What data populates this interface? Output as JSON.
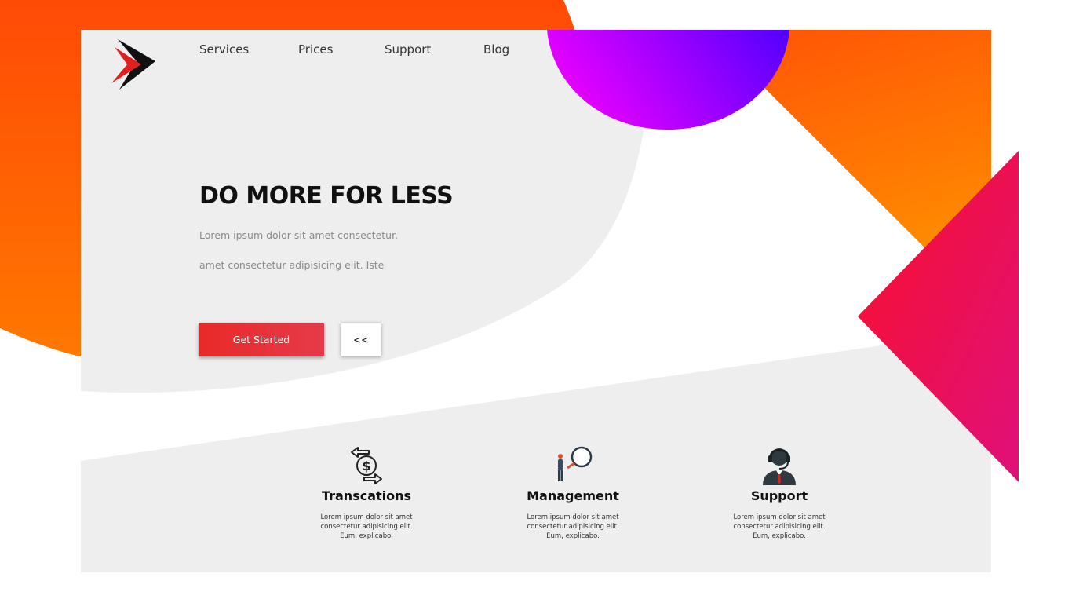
{
  "nav": {
    "items": [
      "Services",
      "Prices",
      "Support",
      "Blog"
    ]
  },
  "hero": {
    "title": "DO MORE FOR LESS",
    "line1": "Lorem ipsum dolor sit amet consectetur.",
    "line2": "amet consectetur adipisicing elit. Iste",
    "primary_button": "Get  Started",
    "secondary_button": "<<"
  },
  "features": [
    {
      "icon": "money-exchange-icon",
      "title": "Transcations",
      "text": "Lorem ipsum dolor sit amet consectetur adipisicing elit. Eum, explicabo."
    },
    {
      "icon": "magnifier-person-icon",
      "title": "Management",
      "text": "Lorem ipsum dolor sit amet consectetur adipisicing elit. Eum, explicabo."
    },
    {
      "icon": "headset-agent-icon",
      "title": "Support",
      "text": "Lorem ipsum dolor sit amet consectetur adipisicing elit. Eum, explicabo."
    }
  ],
  "colors": {
    "accent": "#e82a28",
    "orange": "#ff5a00",
    "purple": "#a000ff",
    "magenta": "#f0103a",
    "panel": "#eeeeee"
  }
}
